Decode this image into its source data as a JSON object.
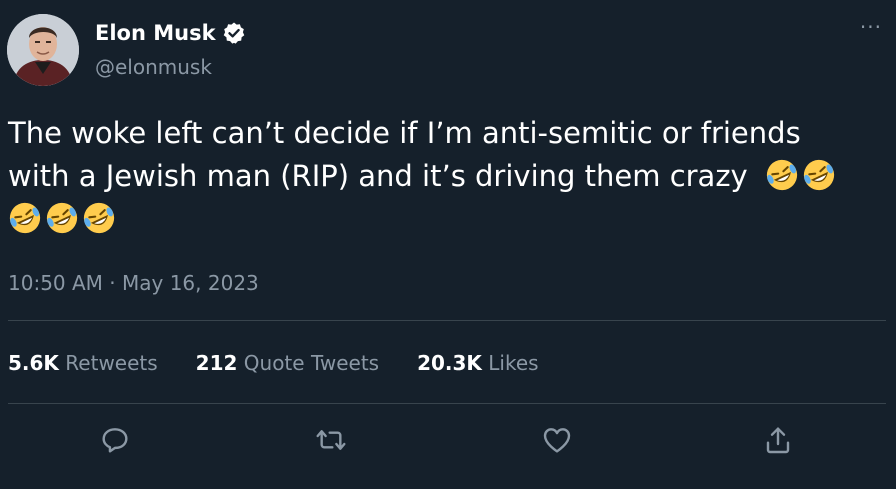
{
  "author": {
    "name": "Elon Musk",
    "handle": "@elonmusk",
    "verified": true,
    "avatar_icon": "avatar-icon"
  },
  "tweet": {
    "line1": "The woke left can’t decide if I’m anti-semitic or friends",
    "line2": "with a Jewish man (RIP) and it’s driving them crazy",
    "emoji": "rolling-on-floor-laughing-emoji",
    "emoji_count": 5
  },
  "timestamp": "10:50 AM · May 16, 2023",
  "stats": {
    "retweets": {
      "value": "5.6K",
      "label": "Retweets"
    },
    "quotes": {
      "value": "212",
      "label": "Quote Tweets"
    },
    "likes": {
      "value": "20.3K",
      "label": "Likes"
    }
  },
  "actions": [
    "reply-icon",
    "retweet-icon",
    "like-icon",
    "share-icon"
  ],
  "colors": {
    "background": "#15202b",
    "text": "#ffffff",
    "muted": "#8b98a5",
    "divider": "#38444d"
  }
}
